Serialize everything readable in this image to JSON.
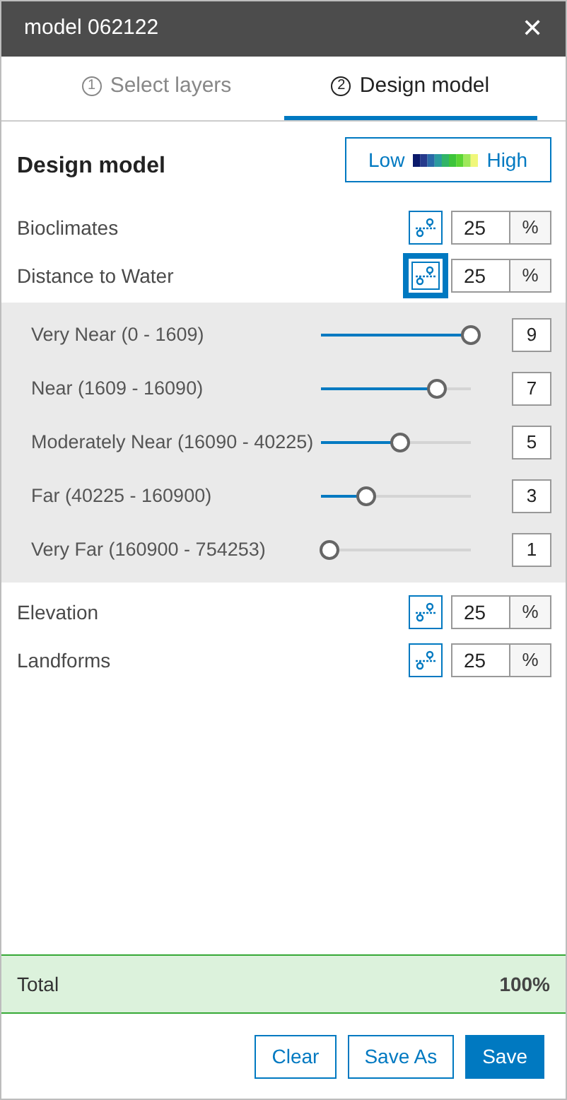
{
  "window": {
    "title": "model 062122",
    "close": "✕"
  },
  "tabs": [
    {
      "number": "1",
      "label": "Select layers",
      "selected": false
    },
    {
      "number": "2",
      "label": "Design model",
      "selected": true
    }
  ],
  "heading": "Design model",
  "legend": {
    "low": "Low",
    "high": "High"
  },
  "layers": [
    {
      "name": "Bioclimates",
      "weight": "25",
      "unit": "%",
      "expanded": false
    },
    {
      "name": "Distance to Water",
      "weight": "25",
      "unit": "%",
      "expanded": true,
      "classes": [
        {
          "label": "Very Near (0 - 1609)",
          "level": 1,
          "value": "9"
        },
        {
          "label": "Near (1609 - 16090)",
          "level": 0.77,
          "value": "7"
        },
        {
          "label": "Moderately Near (16090 - 40225)",
          "level": 0.53,
          "value": "5"
        },
        {
          "label": "Far (40225 - 160900)",
          "level": 0.3,
          "value": "3"
        },
        {
          "label": "Very Far (160900 - 754253)",
          "level": 0.06,
          "value": "1"
        }
      ]
    },
    {
      "name": "Elevation",
      "weight": "25",
      "unit": "%",
      "expanded": false
    },
    {
      "name": "Landforms",
      "weight": "25",
      "unit": "%",
      "expanded": false
    }
  ],
  "total": {
    "label": "Total",
    "value": "100%"
  },
  "buttons": [
    {
      "label": "Clear",
      "kind": "secondary"
    },
    {
      "label": "Save As",
      "kind": "secondary"
    },
    {
      "label": "Save",
      "kind": "primary"
    }
  ]
}
